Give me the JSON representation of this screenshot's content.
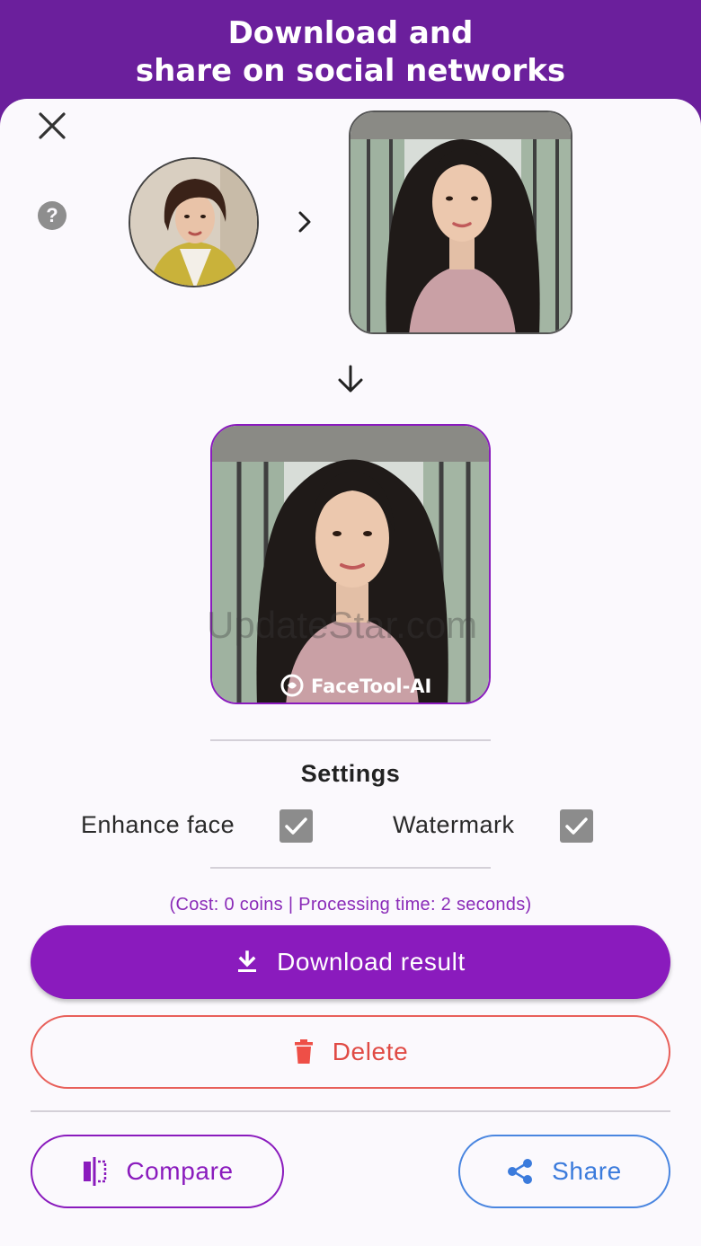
{
  "header": {
    "title": "Download and\nshare on social networks"
  },
  "images": {
    "face_alt": "source face",
    "target_alt": "target photo",
    "result_alt": "result photo",
    "result_badge": "FaceTool-AI"
  },
  "overlay_watermark": "UpdateStar.com",
  "settings": {
    "title": "Settings",
    "options": [
      {
        "label": "Enhance face",
        "checked": true
      },
      {
        "label": "Watermark",
        "checked": true
      }
    ]
  },
  "cost_line": "(Cost: 0 coins | Processing time: 2 seconds)",
  "buttons": {
    "download": "Download result",
    "delete": "Delete",
    "compare": "Compare",
    "share": "Share"
  },
  "colors": {
    "brand_purple": "#8a1bbd",
    "banner_purple": "#6b1f9c",
    "delete_red": "#e04a44",
    "share_blue": "#3b7bdc"
  }
}
